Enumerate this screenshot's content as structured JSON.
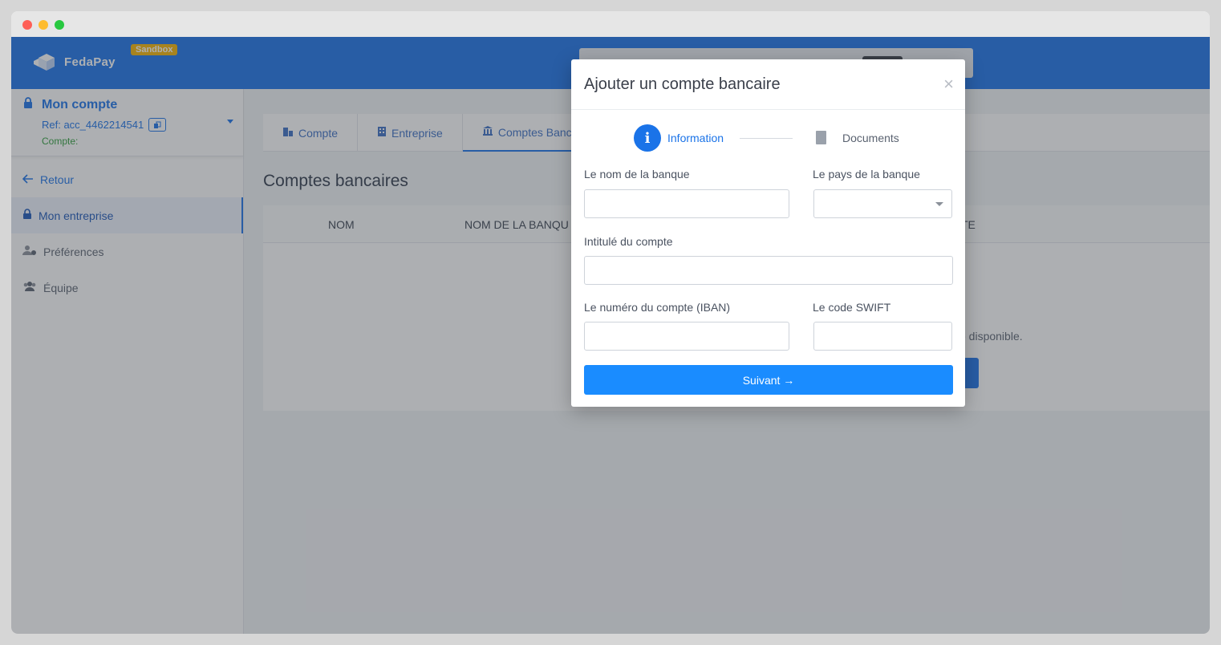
{
  "app": {
    "name": "FedaPay",
    "env_badge": "Sandbox",
    "accent": "#1a73e8"
  },
  "sidebar": {
    "account_title": "Mon compte",
    "account_ref": "Ref: acc_4462214541",
    "account_status": "Compte:",
    "items": [
      {
        "label": "Retour",
        "icon": "arrow-left-icon"
      },
      {
        "label": "Mon entreprise",
        "icon": "lock-icon"
      },
      {
        "label": "Préférences",
        "icon": "user-settings-icon"
      },
      {
        "label": "Équipe",
        "icon": "team-icon"
      }
    ]
  },
  "tabs": [
    {
      "label": "Compte",
      "icon": "building-icon"
    },
    {
      "label": "Entreprise",
      "icon": "office-icon"
    },
    {
      "label": "Comptes Banc",
      "icon": "bank-icon"
    }
  ],
  "main": {
    "section_title": "Comptes bancaires",
    "columns": [
      "NOM",
      "NOM DE LA BANQU",
      "TE"
    ],
    "empty_text": "e disponible."
  },
  "modal": {
    "title": "Ajouter un compte bancaire",
    "close": "×",
    "steps": [
      {
        "label": "Information",
        "marker": "i"
      },
      {
        "label": "Documents"
      }
    ],
    "fields": {
      "bank_name": {
        "label": "Le nom de la banque",
        "value": ""
      },
      "bank_country": {
        "label": "Le pays de la banque",
        "value": ""
      },
      "account_title": {
        "label": "Intitulé du compte",
        "value": ""
      },
      "iban": {
        "label": "Le numéro du compte (IBAN)",
        "value": ""
      },
      "swift": {
        "label": "Le code SWIFT",
        "value": ""
      }
    },
    "next_label": "Suivant →"
  }
}
